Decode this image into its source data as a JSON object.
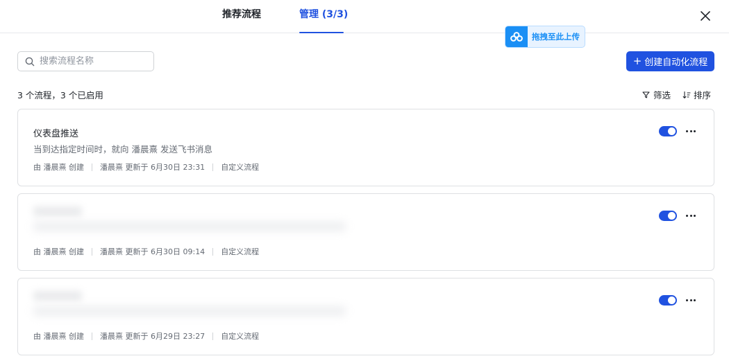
{
  "tabs": [
    {
      "label": "推荐流程"
    },
    {
      "label": "管理 (3/3)"
    }
  ],
  "drop_badge": {
    "label": "拖拽至此上传"
  },
  "search": {
    "placeholder": "搜索流程名称",
    "value": ""
  },
  "create_button": {
    "label": "创建自动化流程"
  },
  "summary": "3 个流程，3 个已启用",
  "toolbar": {
    "filter_label": "筛选",
    "sort_label": "排序"
  },
  "flows": [
    {
      "title": "仪表盘推送",
      "description": "当到达指定时间时，就向 潘晨熹 发送飞书消息",
      "creator": "由 潘晨熹 创建",
      "updated": "潘晨熹 更新于 6月30日 23:31",
      "type": "自定义流程",
      "enabled": true
    },
    {
      "title": "",
      "description": "",
      "creator": "由 潘晨熹 创建",
      "updated": "潘晨熹 更新于 6月30日 09:14",
      "type": "自定义流程",
      "enabled": true
    },
    {
      "title": "",
      "description": "",
      "creator": "由 潘晨熹 创建",
      "updated": "潘晨熹 更新于 6月29日 23:27",
      "type": "自定义流程",
      "enabled": true
    }
  ],
  "colors": {
    "accent": "#2052e0",
    "upload_blue": "#1a8ff5"
  }
}
